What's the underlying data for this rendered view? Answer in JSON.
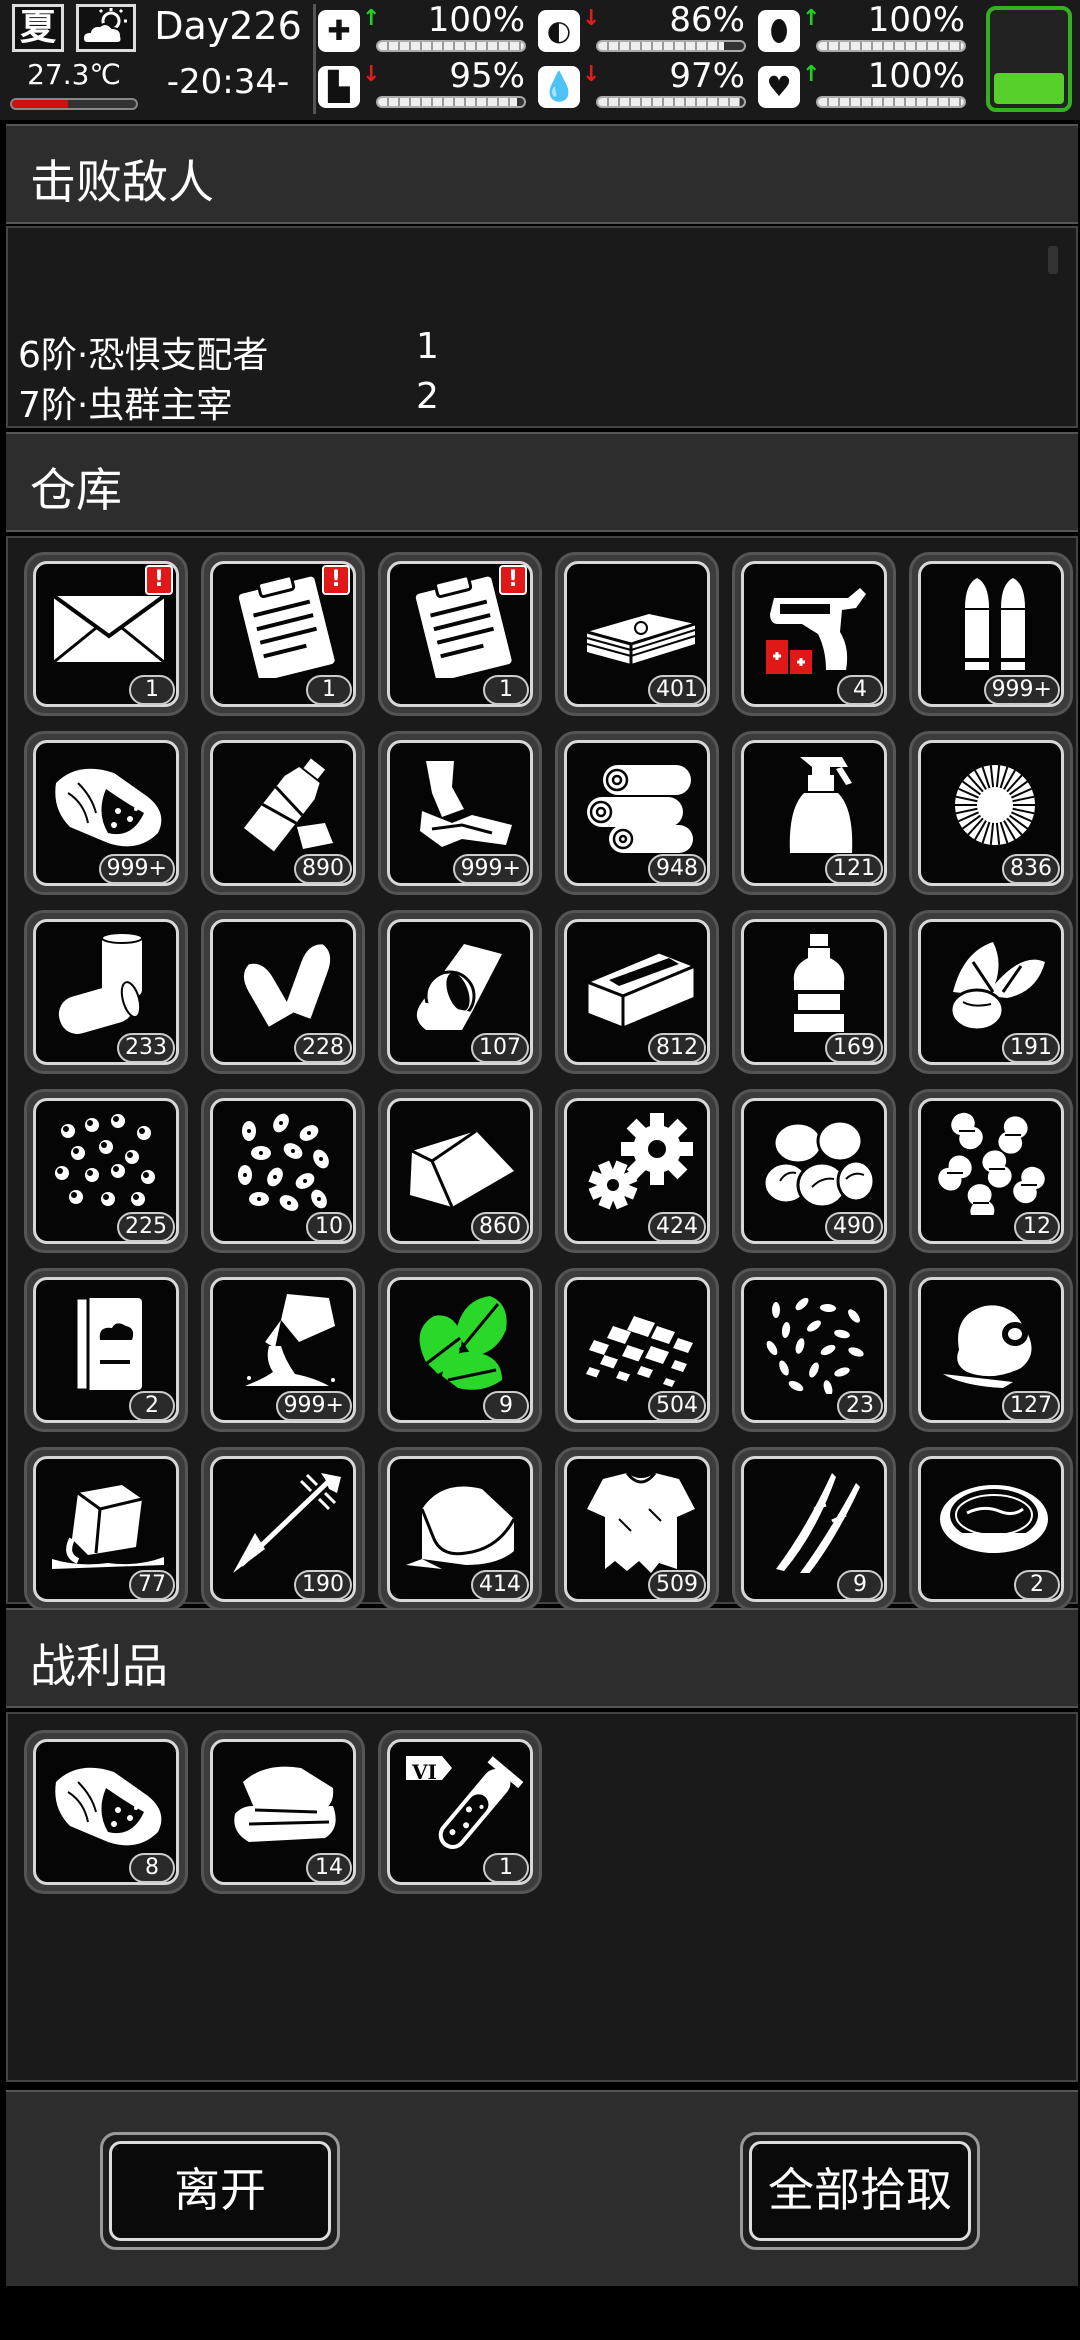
{
  "status": {
    "season": "夏",
    "weather_icon": "sun-cloud-icon",
    "temperature": "27.3℃",
    "temperature_level": 0.45,
    "day": "Day226",
    "time": "-20:34-",
    "stats": [
      {
        "icon": "medkit-icon",
        "arrow": "up",
        "value": "100%",
        "level": 1.0
      },
      {
        "icon": "stomach-icon",
        "arrow": "down",
        "value": "86%",
        "level": 0.86
      },
      {
        "icon": "pill-icon",
        "arrow": "up",
        "value": "100%",
        "level": 1.0
      },
      {
        "icon": "boot-icon",
        "arrow": "down",
        "value": "95%",
        "level": 0.95
      },
      {
        "icon": "water-drop-icon",
        "arrow": "down",
        "value": "97%",
        "level": 0.97
      },
      {
        "icon": "heart-icon",
        "arrow": "up",
        "value": "100%",
        "level": 1.0
      }
    ],
    "battery_level": 0.4,
    "colors": {
      "arrow_up": "#24d024",
      "arrow_down": "#e01c1c",
      "battery": "#58d02c",
      "temp_bar": "#d01010"
    }
  },
  "defeat": {
    "title": "击败敌人",
    "enemies": [
      {
        "name": "6阶·恐惧支配者",
        "count": "1"
      },
      {
        "name": "7阶·虫群主宰",
        "count": "2"
      }
    ]
  },
  "storage": {
    "title": "仓库",
    "items": [
      {
        "icon": "envelope",
        "count": "1",
        "alert": "!"
      },
      {
        "icon": "clipboard",
        "count": "1",
        "alert": "!"
      },
      {
        "icon": "clipboard",
        "count": "1",
        "alert": "!"
      },
      {
        "icon": "cash",
        "count": "401"
      },
      {
        "icon": "flare-gun",
        "count": "4"
      },
      {
        "icon": "bullets",
        "count": "999+"
      },
      {
        "icon": "meat",
        "count": "999+"
      },
      {
        "icon": "plastic-bottle",
        "count": "890"
      },
      {
        "icon": "scrap-metal",
        "count": "999+"
      },
      {
        "icon": "logs",
        "count": "948"
      },
      {
        "icon": "spray-bottle",
        "count": "121"
      },
      {
        "icon": "cotton",
        "count": "836"
      },
      {
        "icon": "cans",
        "count": "233"
      },
      {
        "icon": "shells",
        "count": "228"
      },
      {
        "icon": "bandage-roll",
        "count": "107"
      },
      {
        "icon": "box",
        "count": "812"
      },
      {
        "icon": "oil-bottle",
        "count": "169"
      },
      {
        "icon": "vegetable",
        "count": "191"
      },
      {
        "icon": "seeds",
        "count": "225"
      },
      {
        "icon": "beans",
        "count": "10"
      },
      {
        "icon": "cloth",
        "count": "860"
      },
      {
        "icon": "gears",
        "count": "424"
      },
      {
        "icon": "potatoes",
        "count": "490"
      },
      {
        "icon": "peanuts",
        "count": "12"
      },
      {
        "icon": "book",
        "count": "2"
      },
      {
        "icon": "powder-bag",
        "count": "999+"
      },
      {
        "icon": "herb",
        "count": "9",
        "green": true
      },
      {
        "icon": "gravel",
        "count": "504"
      },
      {
        "icon": "rice",
        "count": "23"
      },
      {
        "icon": "egg",
        "count": "127"
      },
      {
        "icon": "ice",
        "count": "77"
      },
      {
        "icon": "arrow",
        "count": "190"
      },
      {
        "icon": "towel",
        "count": "414"
      },
      {
        "icon": "tattered-shirt",
        "count": "509"
      },
      {
        "icon": "claws",
        "count": "9"
      },
      {
        "icon": "soup-bowl",
        "count": "2"
      }
    ]
  },
  "loot": {
    "title": "战利品",
    "items": [
      {
        "icon": "meat",
        "count": "8"
      },
      {
        "icon": "folded-cloth",
        "count": "14"
      },
      {
        "icon": "test-tube-vi",
        "count": "1",
        "badge": "VI"
      }
    ]
  },
  "buttons": {
    "leave": "离开",
    "take_all": "全部拾取"
  }
}
